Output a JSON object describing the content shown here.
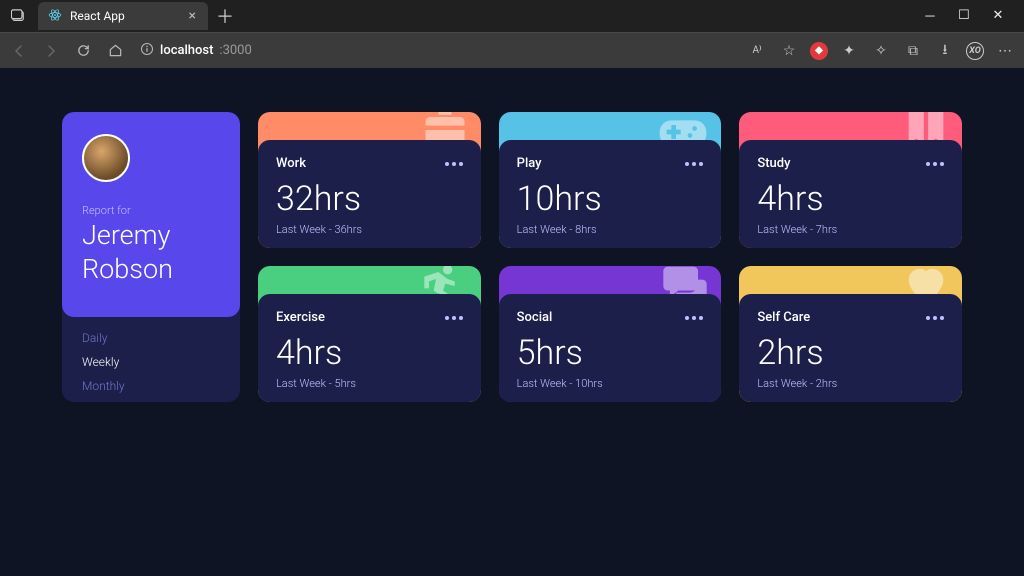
{
  "browser": {
    "tab_title": "React App",
    "url_host": "localhost",
    "url_path": ":3000"
  },
  "profile": {
    "report_label": "Report for",
    "name_line1": "Jeremy",
    "name_line2": "Robson",
    "modes": [
      "Daily",
      "Weekly",
      "Monthly"
    ],
    "active_mode_index": 1
  },
  "prev_prefix": "Last Week - ",
  "cards": [
    {
      "key": "work",
      "title": "Work",
      "hours": "32hrs",
      "prev": "36hrs",
      "bg": "bg-work",
      "icon": "briefcase-icon"
    },
    {
      "key": "play",
      "title": "Play",
      "hours": "10hrs",
      "prev": "8hrs",
      "bg": "bg-play",
      "icon": "gamepad-icon"
    },
    {
      "key": "study",
      "title": "Study",
      "hours": "4hrs",
      "prev": "7hrs",
      "bg": "bg-study",
      "icon": "book-icon"
    },
    {
      "key": "exercise",
      "title": "Exercise",
      "hours": "4hrs",
      "prev": "5hrs",
      "bg": "bg-exercise",
      "icon": "running-icon"
    },
    {
      "key": "social",
      "title": "Social",
      "hours": "5hrs",
      "prev": "10hrs",
      "bg": "bg-social",
      "icon": "chat-icon"
    },
    {
      "key": "selfcare",
      "title": "Self Care",
      "hours": "2hrs",
      "prev": "2hrs",
      "bg": "bg-selfcare",
      "icon": "heart-icon"
    }
  ]
}
